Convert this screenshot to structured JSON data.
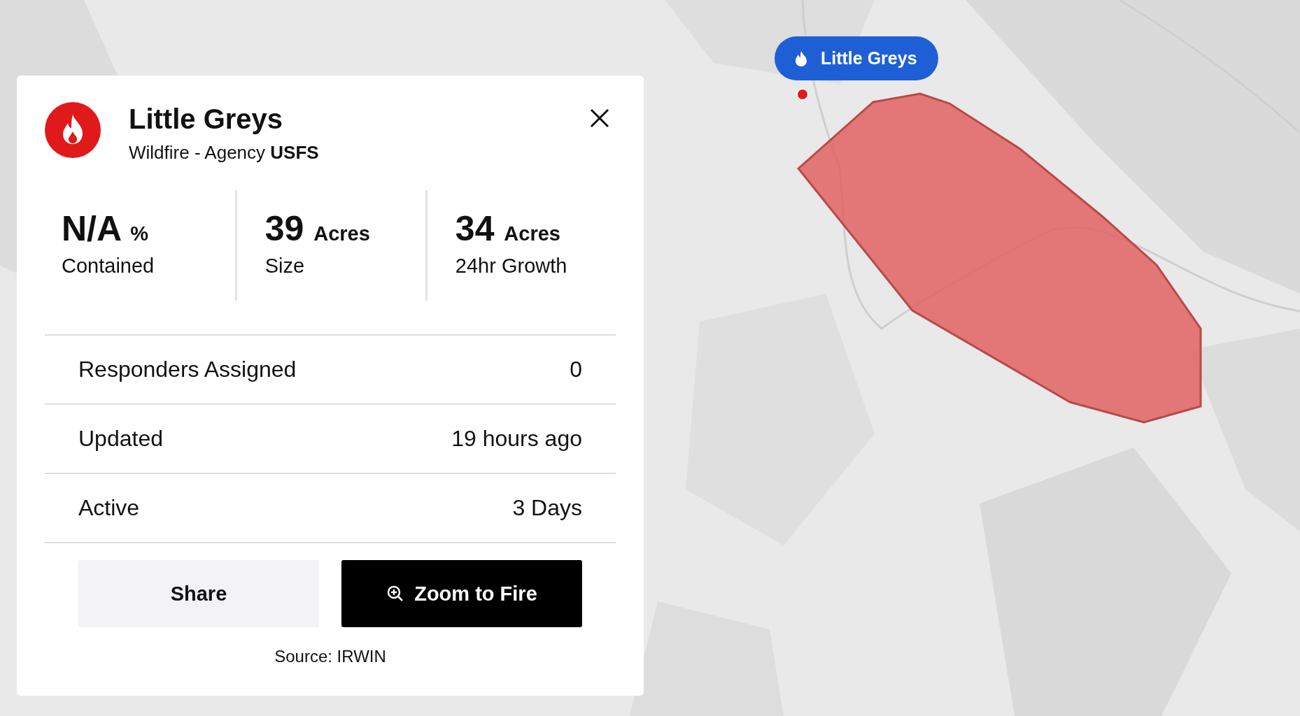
{
  "map_marker": {
    "label": "Little Greys"
  },
  "card": {
    "title": "Little Greys",
    "subtitle": "Wildfire - Agency **USFS**",
    "stats": [
      {
        "value": "N/A",
        "unit": "%",
        "label": "Contained"
      },
      {
        "value": "39",
        "unit": "Acres",
        "label": "Size"
      },
      {
        "value": "34",
        "unit": "Acres",
        "label": "24hr Growth"
      }
    ],
    "rows": [
      {
        "label": "Responders Assigned",
        "value": "0"
      },
      {
        "label": "Updated",
        "value": "19 hours ago"
      },
      {
        "label": "Active",
        "value": "3 Days"
      }
    ],
    "buttons": [
      {
        "label": "Share",
        "kind": "secondary"
      },
      {
        "label": "Zoom to Fire",
        "kind": "primary"
      }
    ],
    "source": "Source: IRWIN"
  }
}
